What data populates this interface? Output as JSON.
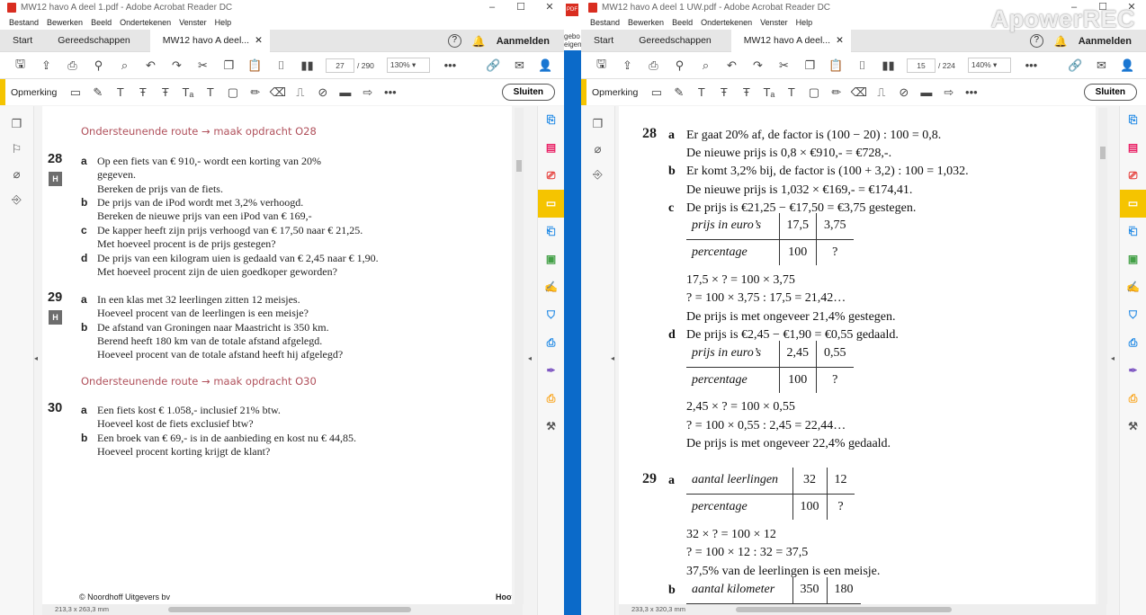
{
  "left_window": {
    "title": "MW12 havo A deel 1.pdf - Adobe Acrobat Reader DC",
    "menu": [
      "Bestand",
      "Bewerken",
      "Beeld",
      "Ondertekenen",
      "Venster",
      "Help"
    ],
    "tabs": {
      "start": "Start",
      "tools": "Gereedschappen",
      "doc": "MW12 havo A deel..."
    },
    "login": "Aanmelden",
    "page_current": "27",
    "page_total": "/ 290",
    "zoom": "130%",
    "comment_label": "Opmerking",
    "close_label": "Sluiten",
    "page_dims": "213,3 x 263,3 mm",
    "content": {
      "route1": "Ondersteunende route → maak opdracht O28",
      "q28": {
        "num": "28",
        "badge": "H",
        "a_label": "a",
        "a1": "Op een fiets van € 910,- wordt een korting van 20%",
        "a2": "gegeven.",
        "a3": "Bereken de prijs van de fiets.",
        "b_label": "b",
        "b1": "De prijs van de iPod wordt met 3,2% verhoogd.",
        "b2": "Bereken de nieuwe prijs van een iPod van € 169,-",
        "c_label": "c",
        "c1": "De kapper heeft zijn prijs verhoogd van € 17,50 naar € 21,25.",
        "c2": "Met hoeveel procent is de prijs gestegen?",
        "d_label": "d",
        "d1": "De prijs van een kilogram uien is gedaald van € 2,45 naar € 1,90.",
        "d2": "Met hoeveel procent zijn de uien goedkoper geworden?"
      },
      "q29": {
        "num": "29",
        "badge": "H",
        "a_label": "a",
        "a1": "In een klas met 32 leerlingen zitten 12 meisjes.",
        "a2": "Hoeveel procent van de leerlingen is een meisje?",
        "b_label": "b",
        "b1": "De afstand van Groningen naar Maastricht is 350 km.",
        "b2": "Berend heeft 180 km van de totale afstand afgelegd.",
        "b3": "Hoeveel procent van de totale afstand heeft hij afgelegd?"
      },
      "route2": "Ondersteunende route → maak opdracht O30",
      "q30": {
        "num": "30",
        "a_label": "a",
        "a1": "Een fiets kost € 1.058,- inclusief 21% btw.",
        "a2": "Hoeveel kost de fiets exclusief btw?",
        "b_label": "b",
        "b1": "Een broek van € 69,- is in de aanbieding en kost nu € 44,85.",
        "b2": "Hoeveel procent korting krijgt de klant?"
      },
      "footer_left": "© Noordhoff Uitgevers bv",
      "footer_right": "Hoof"
    }
  },
  "middle_strip": {
    "text1": "gebo",
    "text2": "eigen"
  },
  "right_window": {
    "title": "MW12 havo A deel 1 UW.pdf - Adobe Acrobat Reader DC",
    "menu": [
      "Bestand",
      "Bewerken",
      "Beeld",
      "Ondertekenen",
      "Venster",
      "Help"
    ],
    "tabs": {
      "start": "Start",
      "tools": "Gereedschappen",
      "doc": "MW12 havo A deel..."
    },
    "login": "Aanmelden",
    "page_current": "15",
    "page_total": "/ 224",
    "zoom": "140%",
    "comment_label": "Opmerking",
    "close_label": "Sluiten",
    "page_dims": "233,3 x 320,3 mm",
    "watermark": "ApowerREC",
    "content": {
      "a28": {
        "num": "28",
        "a_label": "a",
        "a1": "Er gaat 20% af, de factor is (100 − 20) : 100 = 0,8.",
        "a2": "De nieuwe prijs is 0,8 × €910,- = €728,-.",
        "b_label": "b",
        "b1": "Er komt 3,2% bij, de factor is (100 + 3,2) : 100 = 1,032.",
        "b2": "De nieuwe prijs is 1,032 × €169,- = €174,41.",
        "c_label": "c",
        "c1": "De prijs is €21,25 − €17,50 = €3,75 gestegen.",
        "c_table": {
          "h1": "prijs in euro’s",
          "v11": "17,5",
          "v12": "3,75",
          "h2": "percentage",
          "v21": "100",
          "v22": "?"
        },
        "c2": "17,5 × ? = 100 × 3,75",
        "c3": "? = 100 × 3,75 : 17,5 = 21,42…",
        "c4": "De prijs is met ongeveer 21,4% gestegen.",
        "d_label": "d",
        "d1": "De prijs is €2,45 − €1,90 = €0,55 gedaald.",
        "d_table": {
          "h1": "prijs in euro’s",
          "v11": "2,45",
          "v12": "0,55",
          "h2": "percentage",
          "v21": "100",
          "v22": "?"
        },
        "d2": "2,45 × ? = 100 × 0,55",
        "d3": "? = 100 × 0,55 : 2,45 = 22,44…",
        "d4": "De prijs is met ongeveer 22,4% gedaald."
      },
      "a29": {
        "num": "29",
        "a_label": "a",
        "a_table": {
          "h1": "aantal leerlingen",
          "v11": "32",
          "v12": "12",
          "h2": "percentage",
          "v21": "100",
          "v22": "?"
        },
        "a2": "32 × ? = 100 × 12",
        "a3": "? = 100 × 12 : 32 = 37,5",
        "a4": "37,5% van de leerlingen is een meisje.",
        "b_label": "b",
        "b_table": {
          "h1": "aantal kilometer",
          "v11": "350",
          "v12": "180"
        }
      }
    }
  }
}
